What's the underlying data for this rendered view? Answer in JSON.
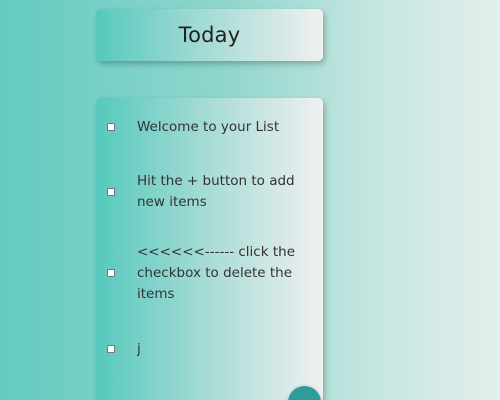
{
  "header": {
    "title": "Today"
  },
  "list": {
    "items": [
      {
        "text": "Welcome to your List",
        "checked": false
      },
      {
        "text": "Hit the + button to add new items",
        "checked": false
      },
      {
        "text": "<<<<<<------ click the checkbox to delete the items",
        "checked": false
      },
      {
        "text": "j",
        "checked": false
      }
    ]
  },
  "colors": {
    "accent": "#2e9c9a",
    "background_left": "#63cbbf",
    "background_right": "#e3efec"
  }
}
